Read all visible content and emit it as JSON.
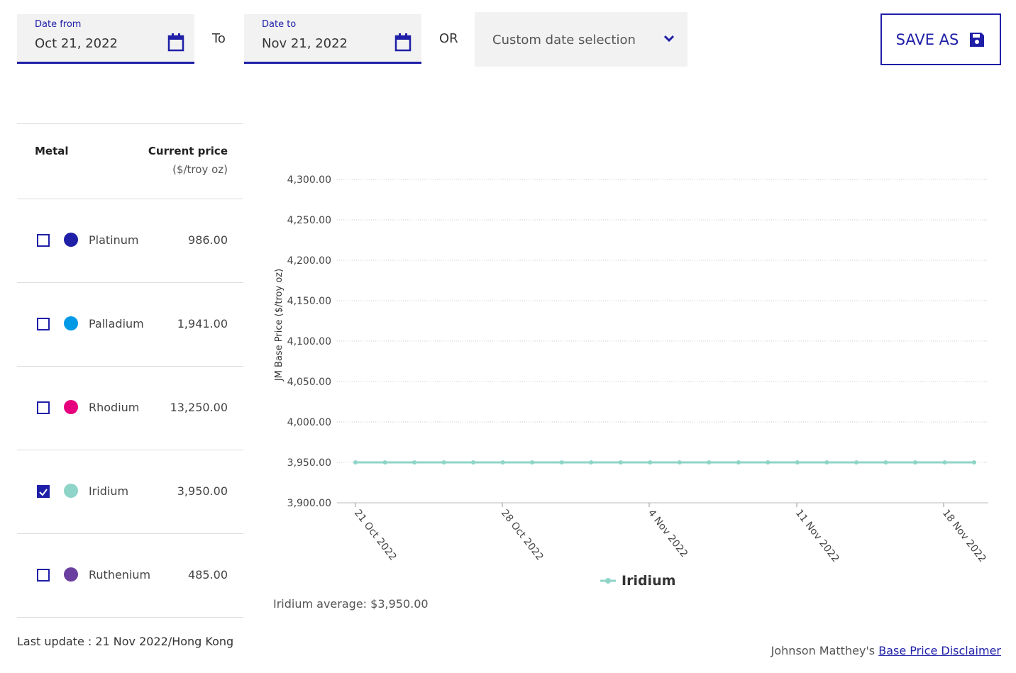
{
  "filters": {
    "date_from": {
      "label": "Date from",
      "value": "Oct 21, 2022"
    },
    "to_label": "To",
    "date_to": {
      "label": "Date to",
      "value": "Nov 21, 2022"
    },
    "or_label": "OR",
    "preset": {
      "value": "Custom date selection"
    },
    "save_label": "SAVE AS"
  },
  "table": {
    "col_metal": "Metal",
    "col_price": "Current price",
    "col_unit": "($/troy oz)",
    "rows": [
      {
        "name": "Platinum",
        "price": "986.00",
        "color": "#1f1fa8",
        "checked": false
      },
      {
        "name": "Palladium",
        "price": "1,941.00",
        "color": "#0099e6",
        "checked": false
      },
      {
        "name": "Rhodium",
        "price": "13,250.00",
        "color": "#e6007e",
        "checked": false
      },
      {
        "name": "Iridium",
        "price": "3,950.00",
        "color": "#8fd4c8",
        "checked": true
      },
      {
        "name": "Ruthenium",
        "price": "485.00",
        "color": "#6b3fa0",
        "checked": false
      }
    ]
  },
  "last_update": "Last update : 21 Nov 2022/Hong Kong",
  "average": "Iridium average: $3,950.00",
  "disclaimer": {
    "prefix": "Johnson Matthey's ",
    "link": "Base Price Disclaimer"
  },
  "chart_data": {
    "type": "line",
    "ylabel": "JM Base Price ($/troy oz)",
    "ylim": [
      3900,
      4300
    ],
    "yticks": [
      "4,300.00",
      "4,250.00",
      "4,200.00",
      "4,150.00",
      "4,100.00",
      "4,050.00",
      "4,000.00",
      "3,950.00",
      "3,900.00"
    ],
    "xticks": [
      "21 Oct 2022",
      "28 Oct 2022",
      "4 Nov 2022",
      "11 Nov 2022",
      "18 Nov 2022"
    ],
    "grid": true,
    "legend": "bottom",
    "series": [
      {
        "name": "Iridium",
        "color": "#8fd4c8",
        "values": [
          3950,
          3950,
          3950,
          3950,
          3950,
          3950,
          3950,
          3950,
          3950,
          3950,
          3950,
          3950,
          3950,
          3950,
          3950,
          3950,
          3950,
          3950,
          3950,
          3950,
          3950,
          3950
        ]
      }
    ]
  }
}
